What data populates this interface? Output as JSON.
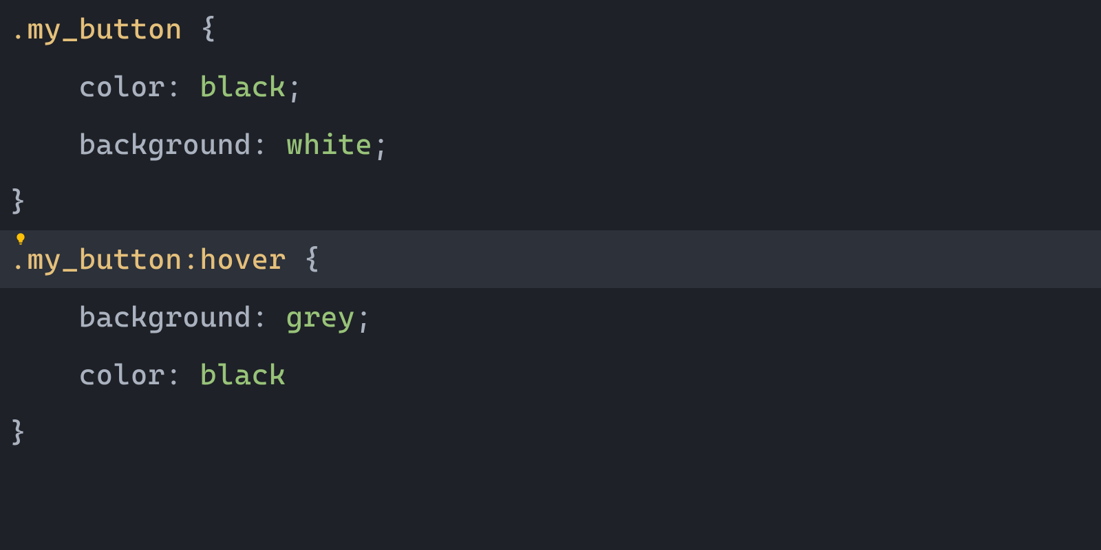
{
  "code": {
    "line1": {
      "selector": ".my_button",
      "brace": " {"
    },
    "line2": {
      "indent": "    ",
      "property": "color",
      "colon": ": ",
      "value": "black",
      "semi": ";"
    },
    "line3": {
      "indent": "    ",
      "property": "background",
      "colon": ": ",
      "value": "white",
      "semi": ";"
    },
    "line4": {
      "brace": "}"
    },
    "line5": {
      "selector": ".my_button:hover",
      "brace": " {"
    },
    "line6": {
      "indent": "    ",
      "property": "background",
      "colon": ": ",
      "value": "grey",
      "semi": ";"
    },
    "line7": {
      "indent": "    ",
      "property": "color",
      "colon": ": ",
      "value": "black",
      "semi": ""
    },
    "line8": {
      "brace": "}"
    }
  },
  "colors": {
    "background": "#1e2127",
    "selector": "#e5c07b",
    "punctuation": "#abb2bf",
    "property": "#abb2bf",
    "value": "#98c379",
    "highlight": "#2c313a",
    "bulb": "#ffc107"
  }
}
